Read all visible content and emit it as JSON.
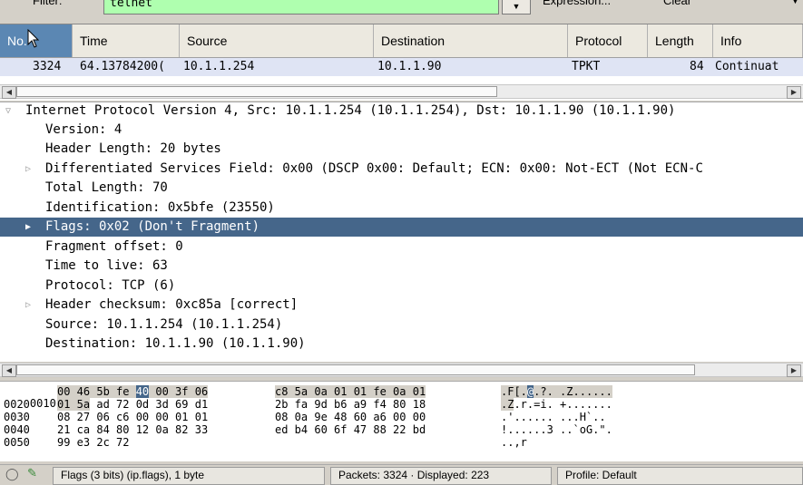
{
  "filter": {
    "label": "Filter:",
    "value": "telnet",
    "expression_label": "Expression...",
    "clear_label": "Clear"
  },
  "packet_list": {
    "columns": [
      "No.",
      "Time",
      "Source",
      "Destination",
      "Protocol",
      "Length",
      "Info"
    ],
    "rows": [
      {
        "no": "3324",
        "time": "64.13784200(",
        "source": "10.1.1.254",
        "destination": "10.1.1.90",
        "protocol": "TPKT",
        "length": "84",
        "info": "Continuat"
      }
    ]
  },
  "details": {
    "rows": [
      {
        "text": "Internet Protocol Version 4, Src: 10.1.1.254 (10.1.1.254), Dst: 10.1.1.90 (10.1.1.90)",
        "toggle": "expanded"
      },
      {
        "text": "Version: 4",
        "toggle": "none"
      },
      {
        "text": "Header Length: 20 bytes",
        "toggle": "none"
      },
      {
        "text": "Differentiated Services Field: 0x00 (DSCP 0x00: Default; ECN: 0x00: Not-ECT (Not ECN-C",
        "toggle": "collapsed"
      },
      {
        "text": "Total Length: 70",
        "toggle": "none"
      },
      {
        "text": "Identification: 0x5bfe (23550)",
        "toggle": "none"
      },
      {
        "text": "Flags: 0x02 (Don't Fragment)",
        "toggle": "collapsed",
        "selected": true
      },
      {
        "text": "Fragment offset: 0",
        "toggle": "none"
      },
      {
        "text": "Time to live: 63",
        "toggle": "none"
      },
      {
        "text": "Protocol: TCP (6)",
        "toggle": "none"
      },
      {
        "text": "Header checksum: 0xc85a [correct]",
        "toggle": "collapsed"
      },
      {
        "text": "Source: 10.1.1.254 (10.1.1.254)",
        "toggle": "none"
      },
      {
        "text": "Destination: 10.1.1.90 (10.1.1.90)",
        "toggle": "none"
      }
    ]
  },
  "bytes": {
    "rows": [
      {
        "offset": "0010",
        "hex1": "00 46 5b fe ",
        "hexSel": "40",
        "hex2": " 00 3f 06",
        "hex3": "c8 5a 0a 01 01 fe 0a 01",
        "ascii1": ".F[.",
        "asciiSel": "@",
        "ascii2": ".?. .Z......"
      },
      {
        "offset": "0020",
        "hex1": "01 5a",
        "hexSel": "",
        "hex2": " ad 72 0d 3d 69 d1",
        "hex3": "2b fa 9d b6 a9 f4 80 18",
        "ascii1": ".Z",
        "asciiSel": "",
        "ascii2": ".r.=i. +......."
      },
      {
        "offset": "0030",
        "hex1": "08 27 06 c6 00 00 01 01",
        "hexSel": "",
        "hex2": "",
        "hex3": "08 0a 9e 48 60 a6 00 00",
        "ascii1": ".'...... ...H`..",
        "asciiSel": "",
        "ascii2": ""
      },
      {
        "offset": "0040",
        "hex1": "21 ca 84 80 12 0a 82 33",
        "hexSel": "",
        "hex2": "",
        "hex3": "ed b4 60 6f 47 88 22 bd",
        "ascii1": "!......3 ..`oG.\".",
        "asciiSel": "",
        "ascii2": ""
      },
      {
        "offset": "0050",
        "hex1": "99 e3 2c 72",
        "hexSel": "",
        "hex2": "",
        "hex3": "",
        "ascii1": "..,r",
        "asciiSel": "",
        "ascii2": ""
      }
    ]
  },
  "status": {
    "field": "Flags (3 bits) (ip.flags), 1 byte",
    "packets": "Packets: 3324 · Displayed: 223",
    "profile": "Profile: Default"
  },
  "colors": {
    "selected_row": "#45668a",
    "packet_row": "#dfe4f4",
    "filter_ok": "#afffaf"
  }
}
